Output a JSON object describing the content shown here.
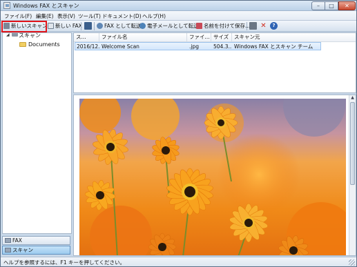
{
  "window": {
    "title": "Windows FAX とスキャン",
    "controls": {
      "minimize": "–",
      "maximize": "□",
      "close": "✕"
    }
  },
  "menubar": {
    "items": [
      "ファイル(F)",
      "編集(E)",
      "表示(V)",
      "ツール(T)",
      "ドキュメント(D)",
      "ヘルプ(H)"
    ]
  },
  "toolbar": {
    "new_scan": "新しいスキャン",
    "new_fax": "新しい FAX",
    "forward_fax": "FAX として転送",
    "forward_email": "電子メールとして転送",
    "save_as": "名前を付けて保存...",
    "highlight_color": "#e0141a"
  },
  "sidebar": {
    "root": "スキャン",
    "folders": [
      "Documents"
    ],
    "nav": [
      {
        "label": "FAX",
        "active": false
      },
      {
        "label": "スキャン",
        "active": true
      }
    ]
  },
  "list": {
    "columns": [
      "ス...",
      "ファイル名",
      "ファイ...",
      "サイズ",
      "スキャン元"
    ],
    "rows": [
      {
        "date": "2016/12...",
        "name": "Welcome Scan",
        "type": ".jpg",
        "size": "504.3...",
        "source": "Windows FAX とスキャン チーム"
      }
    ]
  },
  "preview": {
    "image": "orange-gerbera-flowers",
    "colors": {
      "sky": "#8a80a6",
      "petal": "#f5a21c",
      "center": "#2a1a0a"
    }
  },
  "statusbar": {
    "text": "ヘルプを参照するには、F1 キーを押してください。"
  }
}
